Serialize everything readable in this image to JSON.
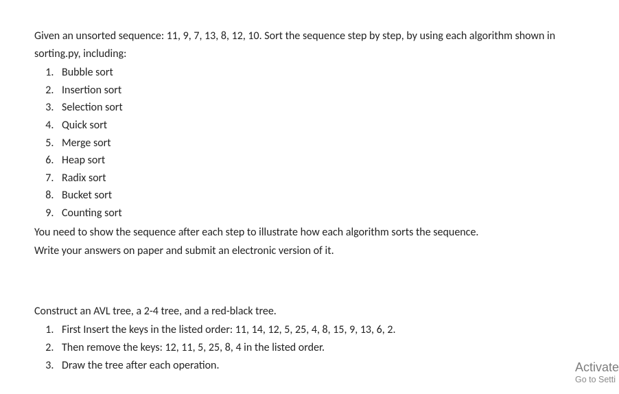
{
  "section1": {
    "intro": "Given an unsorted sequence: 11, 9, 7, 13, 8, 12, 10. Sort the sequence step by step, by using each algorithm shown in sorting.py, including:",
    "items": [
      "Bubble sort",
      "Insertion sort",
      "Selection sort",
      "Quick sort",
      "Merge sort",
      "Heap sort",
      "Radix sort",
      "Bucket sort",
      "Counting sort"
    ],
    "outro1": "You need to show the sequence after each step to illustrate how each algorithm sorts the sequence.",
    "outro2": "Write your answers on paper and submit an electronic version of it."
  },
  "section2": {
    "intro": "Construct an AVL tree, a 2-4 tree, and a red-black tree.",
    "items": [
      "First Insert the keys in the listed order: 11, 14, 12, 5, 25, 4, 8, 15, 9, 13, 6, 2.",
      "Then remove the keys: 12, 11, 5, 25, 8, 4 in the listed order.",
      "Draw the tree after each operation."
    ]
  },
  "watermark": {
    "title": "Activate",
    "sub": "Go to Setti"
  }
}
